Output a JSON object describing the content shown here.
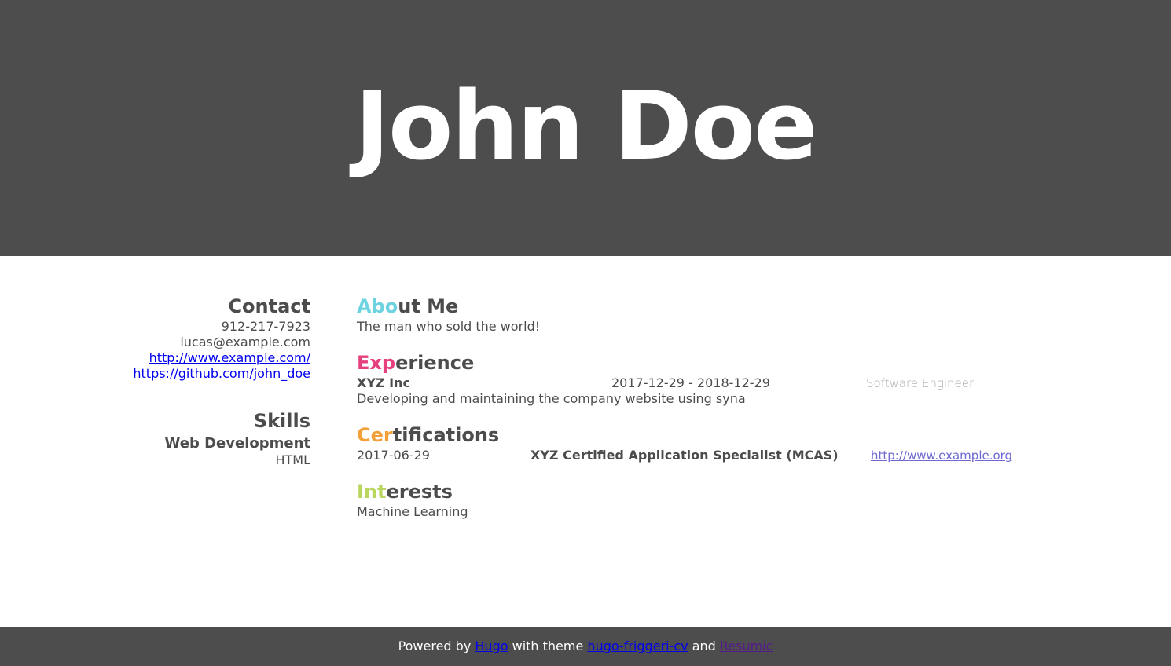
{
  "header": {
    "name": "John Doe"
  },
  "sidebar": {
    "contact_title": "Contact",
    "phone": "912-217-7923",
    "email": "lucas@example.com",
    "website": "http://www.example.com/",
    "github": "https://github.com/john_doe",
    "skills_title": "Skills",
    "skill_category": "Web Development",
    "skill_item": "HTML"
  },
  "main": {
    "about": {
      "title_accent": "Abo",
      "title_rest": "ut Me",
      "text": "The man who sold the world!"
    },
    "experience": {
      "title_accent": "Exp",
      "title_rest": "erience",
      "company": "XYZ Inc",
      "dates": "2017-12-29 - 2018-12-29",
      "role": "Software Engineer",
      "description": "Developing and maintaining the company website using syna"
    },
    "certifications": {
      "title_accent": "Cer",
      "title_rest": "tifications",
      "date": "2017-06-29",
      "name": "XYZ Certified Application Specialist (MCAS)",
      "link": "http://www.example.org"
    },
    "interests": {
      "title_accent": "Int",
      "title_rest": "erests",
      "item": "Machine Learning"
    }
  },
  "footer": {
    "powered_by": "Powered by",
    "hugo": "Hugo",
    "with_theme": "with theme",
    "theme": "hugo-friggeri-cv",
    "and": "and",
    "resumic": "Resumic"
  },
  "colors": {
    "header_bg": "#4d4d4d",
    "about_accent": "#6ed3e0",
    "experience_accent": "#e6407e",
    "certifications_accent": "#f4a039",
    "interests_accent": "#b9d65e"
  }
}
